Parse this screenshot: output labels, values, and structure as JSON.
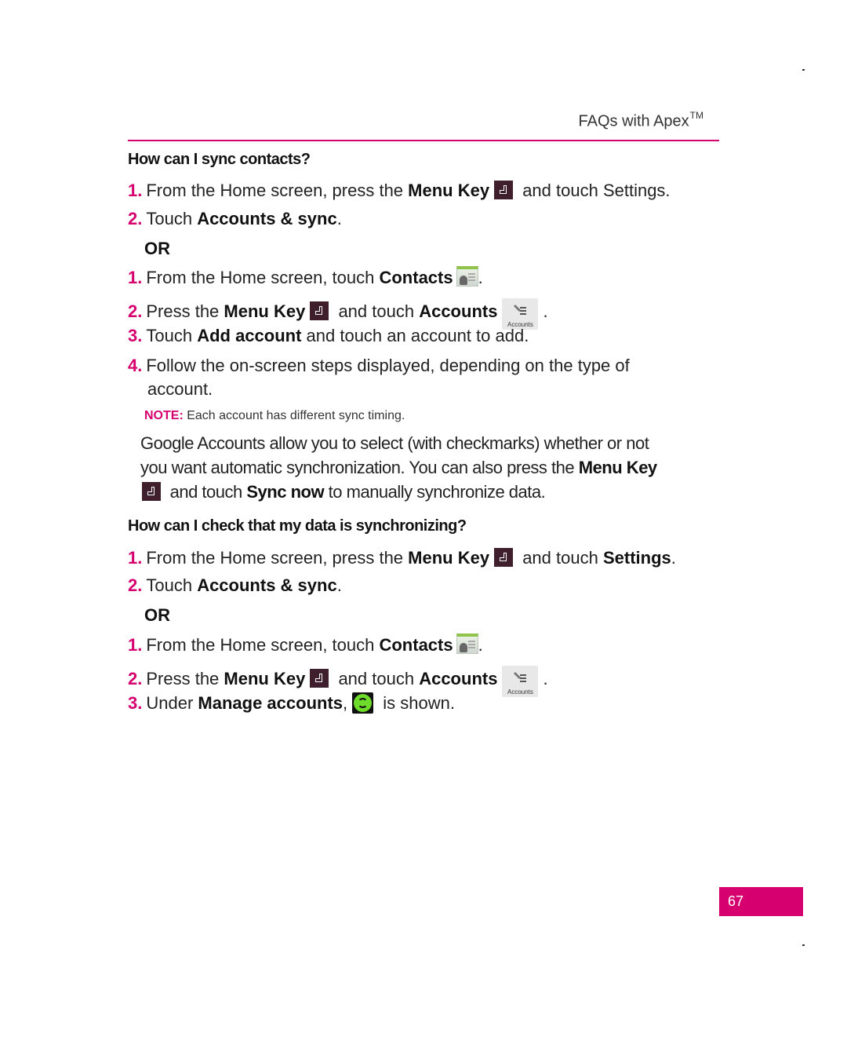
{
  "header": {
    "title": "FAQs with Apex",
    "trademark": "TM"
  },
  "section1": {
    "heading": "How can I sync contacts?",
    "steps_a": [
      {
        "num": "1.",
        "pre": "From the Home screen, press the ",
        "bold": "Menu Key",
        "post": " and touch Settings."
      },
      {
        "num": "2.",
        "pre": "Touch ",
        "bold": "Accounts & sync",
        "post": "."
      }
    ],
    "or": "OR",
    "steps_b": [
      {
        "num": "1.",
        "pre": "From the Home screen, touch ",
        "bold": "Contacts",
        "post": "."
      },
      {
        "num": "2.",
        "pre": "Press the ",
        "bold": "Menu Key",
        "mid": " and touch ",
        "bold2": "Accounts",
        "post": "."
      },
      {
        "num": "3.",
        "pre": "Touch ",
        "bold": "Add account",
        "post": " and touch an account to add."
      },
      {
        "num": "4.",
        "pre": "Follow the on-screen steps displayed, depending on the type of",
        "cont": "account."
      }
    ],
    "note_label": "NOTE:",
    "note_text": " Each account has different sync timing.",
    "para_line1": "Google Accounts allow you to select (with checkmarks) whether or not",
    "para_line2_pre": "you want automatic synchronization. You can also press the ",
    "para_line2_bold": "Menu Key",
    "para_line3_pre": " and touch ",
    "para_line3_bold": "Sync now",
    "para_line3_post": " to manually synchronize data."
  },
  "section2": {
    "heading": "How can I check that my data is synchronizing?",
    "steps_a": [
      {
        "num": "1.",
        "pre": "From the Home screen, press the ",
        "bold": "Menu Key",
        "mid": " and touch ",
        "bold2": "Settings",
        "post": "."
      },
      {
        "num": "2.",
        "pre": "Touch ",
        "bold": "Accounts & sync",
        "post": "."
      }
    ],
    "or": "OR",
    "steps_b": [
      {
        "num": "1.",
        "pre": "From the Home screen, touch ",
        "bold": "Contacts",
        "post": "."
      },
      {
        "num": "2.",
        "pre": "Press the ",
        "bold": "Menu Key",
        "mid": " and touch ",
        "bold2": "Accounts",
        "post": "."
      },
      {
        "num": "3.",
        "pre": "Under ",
        "bold": "Manage accounts",
        "mid": ",",
        "post": " is shown."
      }
    ]
  },
  "icons": {
    "menu_key": "menu-key-icon",
    "contacts": "contacts-icon",
    "accounts": "accounts-icon",
    "accounts_label": "Accounts",
    "sync": "sync-icon"
  },
  "colors": {
    "accent": "#d6006f",
    "menu_key": "#3e1f2b",
    "sync_green": "#6ddc2a"
  },
  "footer": {
    "page_number": "67"
  }
}
